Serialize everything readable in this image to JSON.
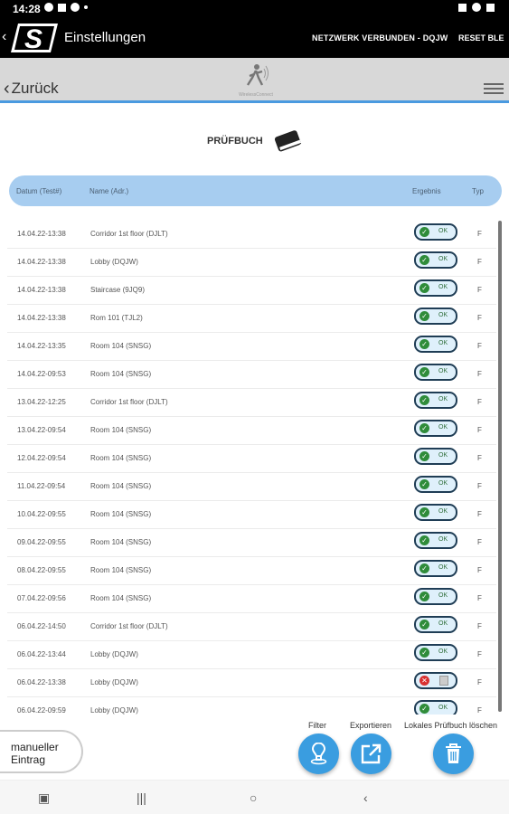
{
  "status_bar": {
    "time": "14:28"
  },
  "app_bar": {
    "title": "Einstellungen",
    "network_status": "NETZWERK VERBUNDEN - DQJW",
    "reset_label": "RESET BLE"
  },
  "nav": {
    "back_label": "Zurück",
    "logo_text": "WirelessConnect"
  },
  "page": {
    "title": "PRÜFBUCH"
  },
  "table": {
    "headers": {
      "date": "Datum (Test#)",
      "name": "Name (Adr.)",
      "result": "Ergebnis",
      "type": "Typ"
    },
    "ok_label": "OK",
    "rows": [
      {
        "date": "14.04.22-13:38",
        "name": "Corridor 1st floor (DJLT)",
        "result": "ok",
        "type": "F"
      },
      {
        "date": "14.04.22-13:38",
        "name": "Lobby (DQJW)",
        "result": "ok",
        "type": "F"
      },
      {
        "date": "14.04.22-13:38",
        "name": "Staircase (9JQ9)",
        "result": "ok",
        "type": "F"
      },
      {
        "date": "14.04.22-13:38",
        "name": "Rom 101 (TJL2)",
        "result": "ok",
        "type": "F"
      },
      {
        "date": "14.04.22-13:35",
        "name": "Room 104 (SNSG)",
        "result": "ok",
        "type": "F"
      },
      {
        "date": "14.04.22-09:53",
        "name": "Room 104 (SNSG)",
        "result": "ok",
        "type": "F"
      },
      {
        "date": "13.04.22-12:25",
        "name": "Corridor 1st floor (DJLT)",
        "result": "ok",
        "type": "F"
      },
      {
        "date": "13.04.22-09:54",
        "name": "Room 104 (SNSG)",
        "result": "ok",
        "type": "F"
      },
      {
        "date": "12.04.22-09:54",
        "name": "Room 104 (SNSG)",
        "result": "ok",
        "type": "F"
      },
      {
        "date": "11.04.22-09:54",
        "name": "Room 104 (SNSG)",
        "result": "ok",
        "type": "F"
      },
      {
        "date": "10.04.22-09:55",
        "name": "Room 104 (SNSG)",
        "result": "ok",
        "type": "F"
      },
      {
        "date": "09.04.22-09:55",
        "name": "Room 104 (SNSG)",
        "result": "ok",
        "type": "F"
      },
      {
        "date": "08.04.22-09:55",
        "name": "Room 104 (SNSG)",
        "result": "ok",
        "type": "F"
      },
      {
        "date": "07.04.22-09:56",
        "name": "Room 104 (SNSG)",
        "result": "ok",
        "type": "F"
      },
      {
        "date": "06.04.22-14:50",
        "name": "Corridor 1st floor (DJLT)",
        "result": "ok",
        "type": "F"
      },
      {
        "date": "06.04.22-13:44",
        "name": "Lobby (DQJW)",
        "result": "ok",
        "type": "F"
      },
      {
        "date": "06.04.22-13:38",
        "name": "Lobby (DQJW)",
        "result": "error",
        "type": "F"
      },
      {
        "date": "06.04.22-09:59",
        "name": "Lobby (DQJW)",
        "result": "ok",
        "type": "F"
      }
    ]
  },
  "actions": {
    "manual_entry_line1": "manueller",
    "manual_entry_line2": "Eintrag",
    "filter_label": "Filter",
    "export_label": "Exportieren",
    "delete_label": "Lokales Prüfbuch löschen"
  },
  "colors": {
    "accent": "#3a9de0",
    "header_bg": "#a7cdf0",
    "ok_green": "#2f8c3a",
    "error_red": "#d83030"
  }
}
